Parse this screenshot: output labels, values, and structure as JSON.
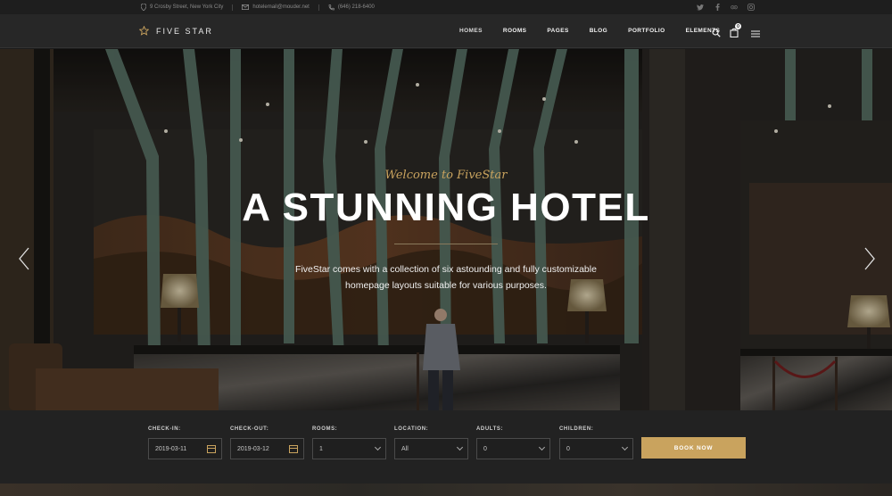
{
  "topbar": {
    "address": "9 Crosby Street, New York City",
    "email": "hotelemail@mouder.net",
    "phone": "(646) 218-6400",
    "social_icons": [
      "twitter-icon",
      "facebook-icon",
      "tripadvisor-icon",
      "instagram-icon"
    ]
  },
  "header": {
    "logo_text": "FIVE STAR",
    "nav": [
      "HOMES",
      "ROOMS",
      "PAGES",
      "BLOG",
      "PORTFOLIO",
      "ELEMENTS"
    ],
    "cart_count": "0"
  },
  "hero": {
    "subtitle": "Welcome to FiveStar",
    "title": "A STUNNING HOTEL",
    "description_line1": "FiveStar comes with a collection of six astounding and fully customizable",
    "description_line2": "homepage layouts suitable for various purposes."
  },
  "booking": {
    "checkin_label": "CHECK-IN:",
    "checkin_value": "2019-03-11",
    "checkout_label": "CHECK-OUT:",
    "checkout_value": "2019-03-12",
    "rooms_label": "ROOMS:",
    "rooms_value": "1",
    "location_label": "LOCATION:",
    "location_value": "All",
    "adults_label": "ADULTS:",
    "adults_value": "0",
    "children_label": "CHILDREN:",
    "children_value": "0",
    "book_label": "BOOK NOW"
  },
  "colors": {
    "accent": "#c9a35e",
    "topbar_bg": "#1e1e1e",
    "header_bg": "#272727",
    "booking_bg": "#222222"
  }
}
